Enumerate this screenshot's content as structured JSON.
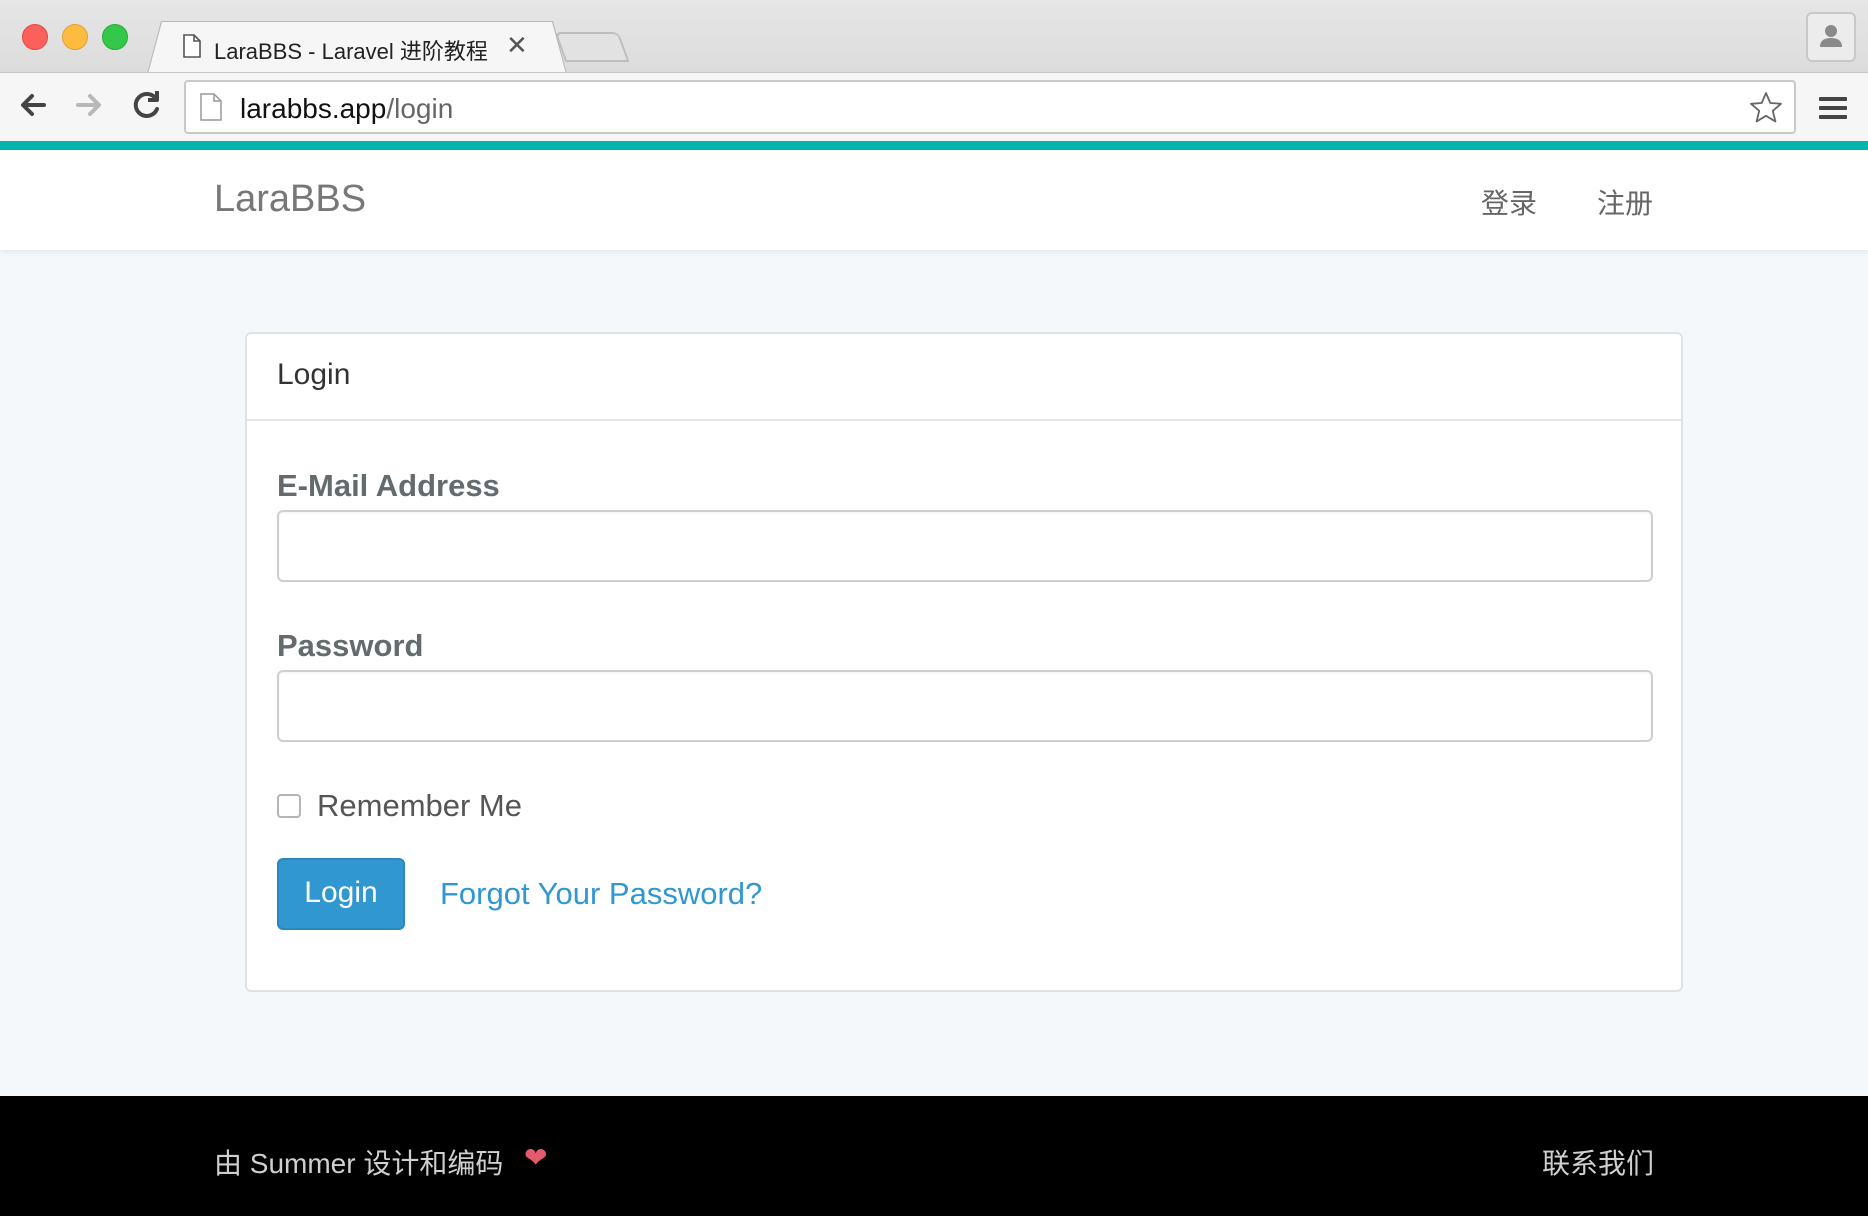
{
  "browser": {
    "tab_title": "LaraBBS - Laravel 进阶教程",
    "tab_close": "✕",
    "url_host": "larabbs.app",
    "url_path": "/login"
  },
  "navbar": {
    "brand": "LaraBBS",
    "login_link": "登录",
    "register_link": "注册"
  },
  "login_panel": {
    "title": "Login",
    "email_label": "E-Mail Address",
    "email_value": "",
    "password_label": "Password",
    "password_value": "",
    "remember_label": "Remember Me",
    "remember_checked": false,
    "submit_label": "Login",
    "forgot_label": "Forgot Your Password?"
  },
  "footer": {
    "credit": "由 Summer 设计和编码",
    "heart": "❤",
    "contact": "联系我们"
  },
  "colors": {
    "accent_bar": "#00b5ad",
    "primary": "#3097d1",
    "heart": "#e35b6c",
    "footer_bg": "#000000",
    "page_bg": "#f5f8fa"
  },
  "icons": {
    "tab": "document-icon",
    "back": "back-arrow-icon",
    "forward": "forward-arrow-icon",
    "reload": "reload-icon",
    "bookmark": "star-icon",
    "menu": "hamburger-menu-icon",
    "profile": "user-profile-icon"
  }
}
